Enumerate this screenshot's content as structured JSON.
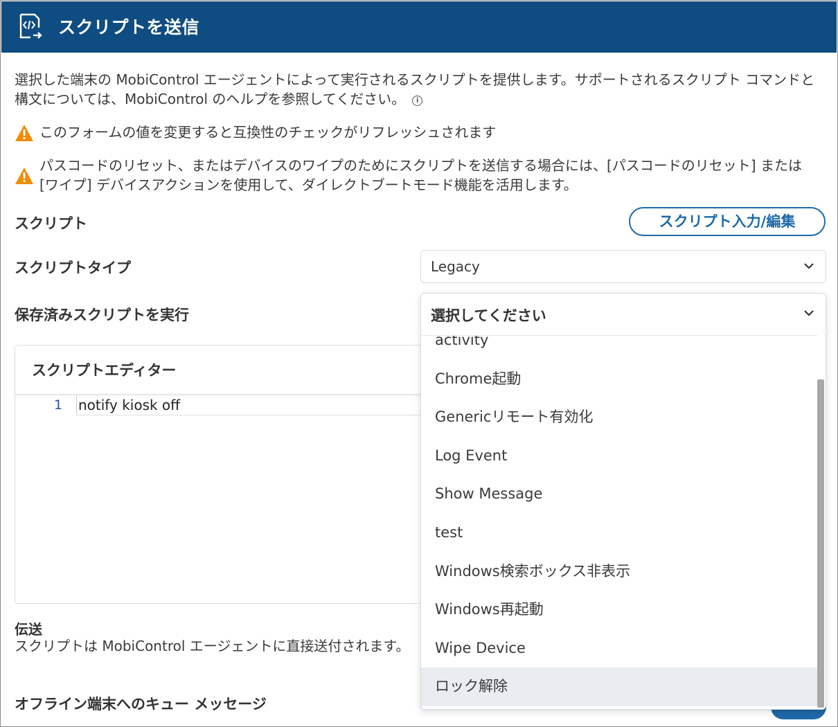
{
  "header": {
    "title": "スクリプトを送信",
    "icon": "script-send-icon",
    "bg_color": "#0f4c81"
  },
  "description": "選択した端末の MobiControl エージェントによって実行されるスクリプトを提供します。サポートされるスクリプト コマンドと構文については、MobiControl のヘルプを参照してください。",
  "warnings": [
    "このフォームの値を変更すると互換性のチェックがリフレッシュされます",
    "パスコードのリセット、またはデバイスのワイプのためにスクリプトを送信する場合には、[パスコードのリセット] または [ワイプ] デバイスアクションを使用して、ダイレクトブートモード機能を活用します。"
  ],
  "script": {
    "label": "スクリプト",
    "edit_button": "スクリプト入力/編集"
  },
  "script_type": {
    "label": "スクリプトタイプ",
    "value": "Legacy"
  },
  "saved_script": {
    "label": "保存済みスクリプトを実行",
    "placeholder": "選択してください",
    "options": [
      "activity",
      "Chrome起動",
      "Genericリモート有効化",
      "Log Event",
      "Show Message",
      "test",
      "Windows検索ボックス非表示",
      "Windows再起動",
      "Wipe Device",
      "ロック解除"
    ],
    "highlighted_index": 9
  },
  "editor": {
    "title": "スクリプトエディター",
    "lines": [
      {
        "num": "1",
        "code": "notify kiosk off"
      }
    ]
  },
  "transfer": {
    "label": "伝送",
    "text": "スクリプトは MobiControl エージェントに直接送付されます。"
  },
  "offline_queue": {
    "label": "オフライン端末へのキュー メッセージ",
    "enabled": true
  },
  "colors": {
    "accent": "#1e6aa8",
    "warning": "#f08c00"
  }
}
